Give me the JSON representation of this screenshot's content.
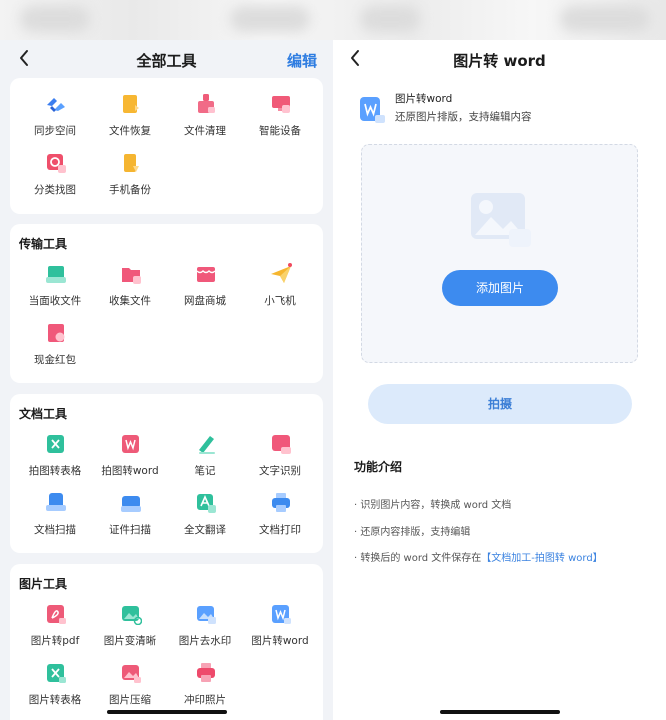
{
  "left": {
    "title": "全部工具",
    "edit": "编辑",
    "sections": [
      {
        "title": "",
        "tools": [
          "同步空间",
          "文件恢复",
          "文件清理",
          "智能设备",
          "分类找图",
          "手机备份"
        ]
      },
      {
        "title": "传输工具",
        "tools": [
          "当面收文件",
          "收集文件",
          "网盘商城",
          "小飞机",
          "现金红包"
        ]
      },
      {
        "title": "文档工具",
        "tools": [
          "拍图转表格",
          "拍图转word",
          "笔记",
          "文字识别",
          "文档扫描",
          "证件扫描",
          "全文翻译",
          "文档打印"
        ]
      },
      {
        "title": "图片工具",
        "tools": [
          "图片转pdf",
          "图片变清晰",
          "图片去水印",
          "图片转word",
          "图片转表格",
          "图片压缩",
          "冲印照片"
        ]
      }
    ]
  },
  "right": {
    "title": "图片转 word",
    "feature_name": "图片转word",
    "feature_desc": "还原图片排版，支持编辑内容",
    "add_image": "添加图片",
    "shoot": "拍摄",
    "intro_title": "功能介绍",
    "intro_items": [
      "· 识别图片内容，转换成 word 文档",
      "· 还原内容排版，支持编辑"
    ],
    "intro_last_prefix": "· 转换后的 word 文件保存在",
    "intro_last_link": "【文档加工-拍图转 word】"
  },
  "colors": {
    "accent": "#3d8bef",
    "edit": "#2f7de1",
    "panel_bg": "#f1f3f7"
  }
}
